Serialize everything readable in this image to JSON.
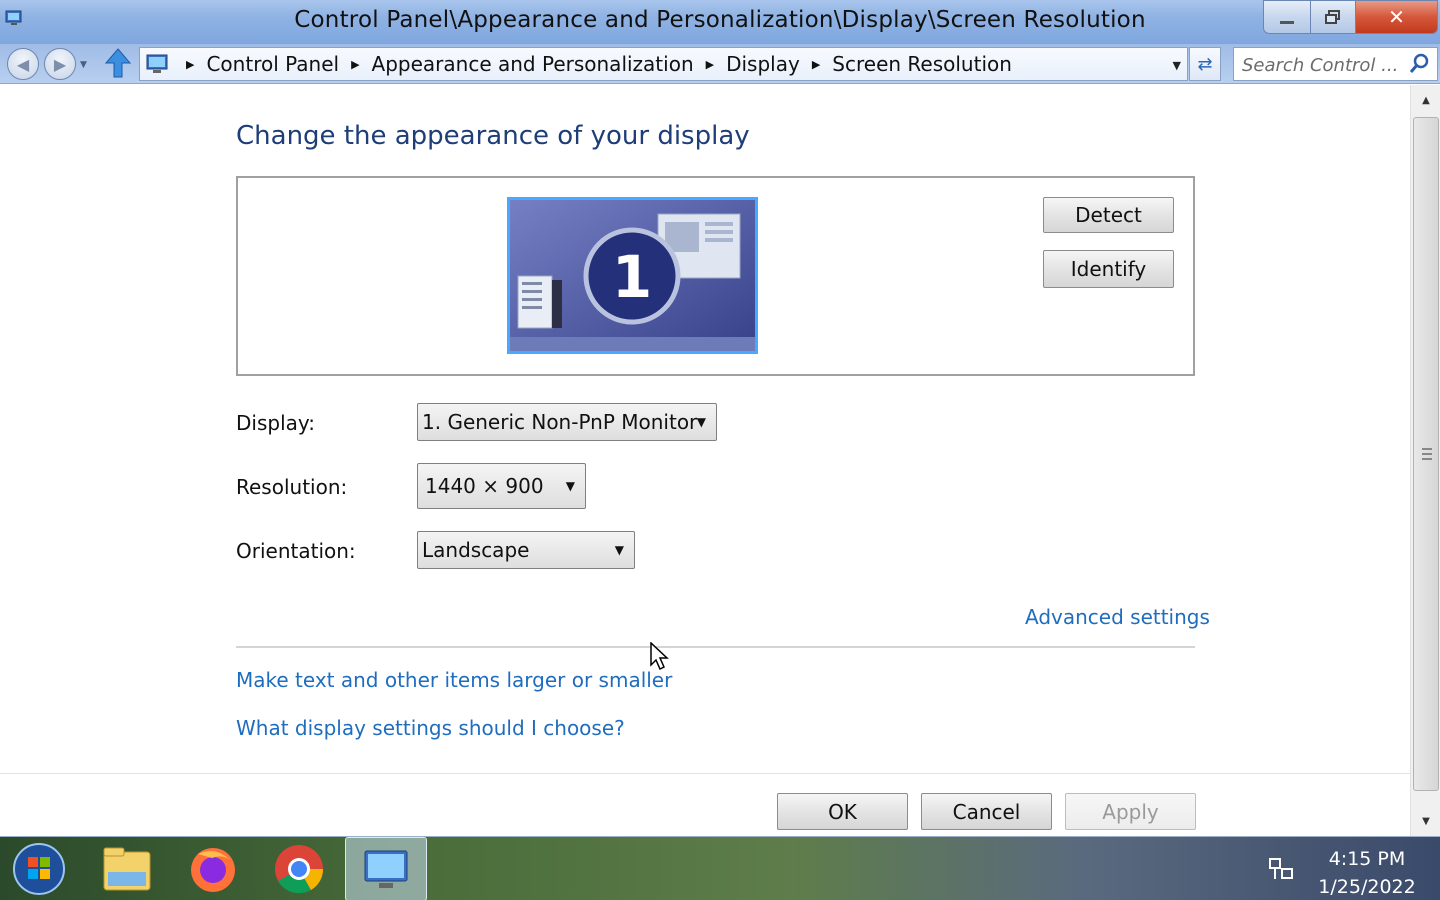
{
  "window": {
    "title": "Control Panel\\Appearance and Personalization\\Display\\Screen Resolution",
    "controls": {
      "minimize": "minimize",
      "maximize": "restore",
      "close": "✕"
    }
  },
  "address_bar": {
    "breadcrumbs": [
      "Control Panel",
      "Appearance and Personalization",
      "Display",
      "Screen Resolution"
    ],
    "search_placeholder": "Search Control ..."
  },
  "main": {
    "heading": "Change the appearance of your display",
    "monitor_number": "1",
    "buttons": {
      "detect": "Detect",
      "identify": "Identify"
    },
    "fields": {
      "display": {
        "label": "Display:",
        "value": "1. Generic Non-PnP Monitor"
      },
      "resolution": {
        "label": "Resolution:",
        "value": "1440 × 900"
      },
      "orientation": {
        "label": "Orientation:",
        "value": "Landscape"
      }
    },
    "advanced_link": "Advanced settings",
    "links": [
      "Make text and other items larger or smaller",
      "What display settings should I choose?"
    ],
    "footer_buttons": {
      "ok": "OK",
      "cancel": "Cancel",
      "apply": "Apply"
    }
  },
  "taskbar": {
    "apps": [
      "start-orb",
      "file-explorer",
      "firefox",
      "chrome",
      "control-panel-display"
    ],
    "clock": {
      "time": "4:15 PM",
      "date": "1/25/2022"
    }
  },
  "colors": {
    "link": "#1f6dbf",
    "heading": "#1e3e7a",
    "close": "#c94a2c",
    "monitor": "#4a55a2"
  }
}
